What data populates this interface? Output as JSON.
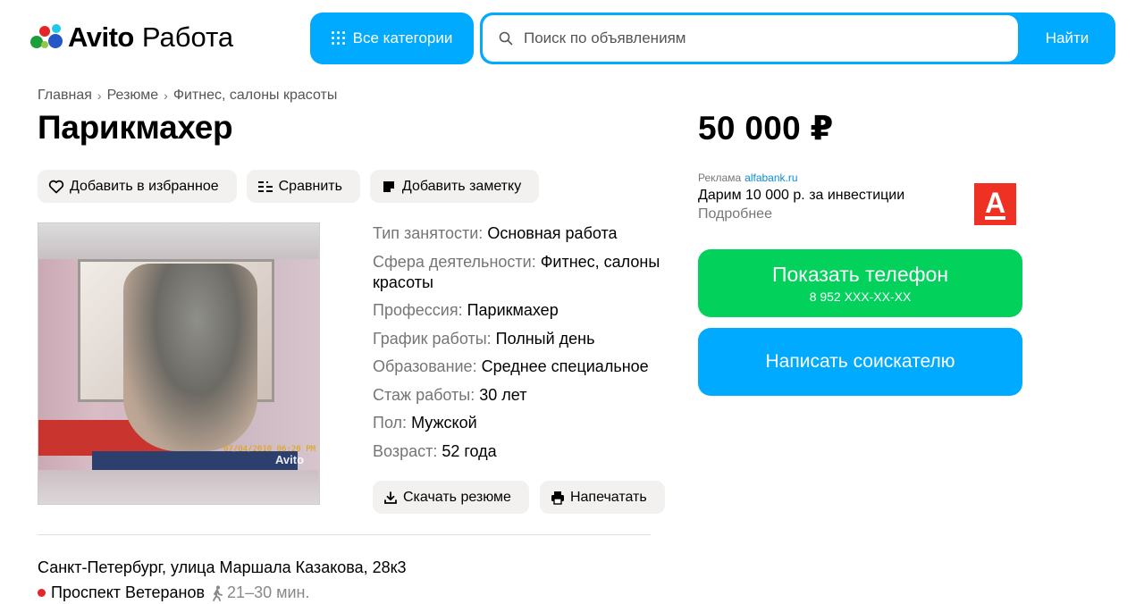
{
  "header": {
    "logo_brand": "Avito",
    "logo_section": "Работа",
    "categories_label": "Все категории",
    "search_placeholder": "Поиск по объявлениям",
    "search_button": "Найти"
  },
  "breadcrumb": [
    "Главная",
    "Резюме",
    "Фитнес, салоны красоты"
  ],
  "title": "Парикмахер",
  "actions": {
    "favorite": "Добавить в избранное",
    "compare": "Сравнить",
    "note": "Добавить заметку"
  },
  "photo": {
    "timestamp": "07/04/2010 06:20 PM",
    "watermark": "Avito"
  },
  "details": [
    {
      "key": "Тип занятости:",
      "value": "Основная работа"
    },
    {
      "key": "Сфера деятельности:",
      "value": "Фитнес, салоны красоты"
    },
    {
      "key": "Профессия:",
      "value": "Парикмахер"
    },
    {
      "key": "График работы:",
      "value": "Полный день"
    },
    {
      "key": "Образование:",
      "value": "Среднее специальное"
    },
    {
      "key": "Стаж работы:",
      "value": "30 лет"
    },
    {
      "key": "Пол:",
      "value": "Мужской"
    },
    {
      "key": "Возраст:",
      "value": "52 года"
    }
  ],
  "bottom_actions": {
    "download": "Скачать резюме",
    "print": "Напечатать"
  },
  "location": {
    "address": "Санкт-Петербург, улица Маршала Казакова, 28к3",
    "metro": "Проспект Ветеранов",
    "walk_time": "21–30 мин.",
    "metro_color": "#e3262a"
  },
  "price": "50 000 ₽",
  "ad": {
    "label": "Реклама",
    "domain": "alfabank.ru",
    "text": "Дарим 10 000 р. за инвестиции",
    "more": "Подробнее",
    "logo_letter": "А"
  },
  "contact": {
    "show_phone": "Показать телефон",
    "phone_masked": "8 952 XXX-XX-XX",
    "write": "Написать соискателю"
  },
  "colors": {
    "accent_blue": "#00aaff",
    "phone_green": "#02d15c",
    "alfa_red": "#ef3124"
  }
}
